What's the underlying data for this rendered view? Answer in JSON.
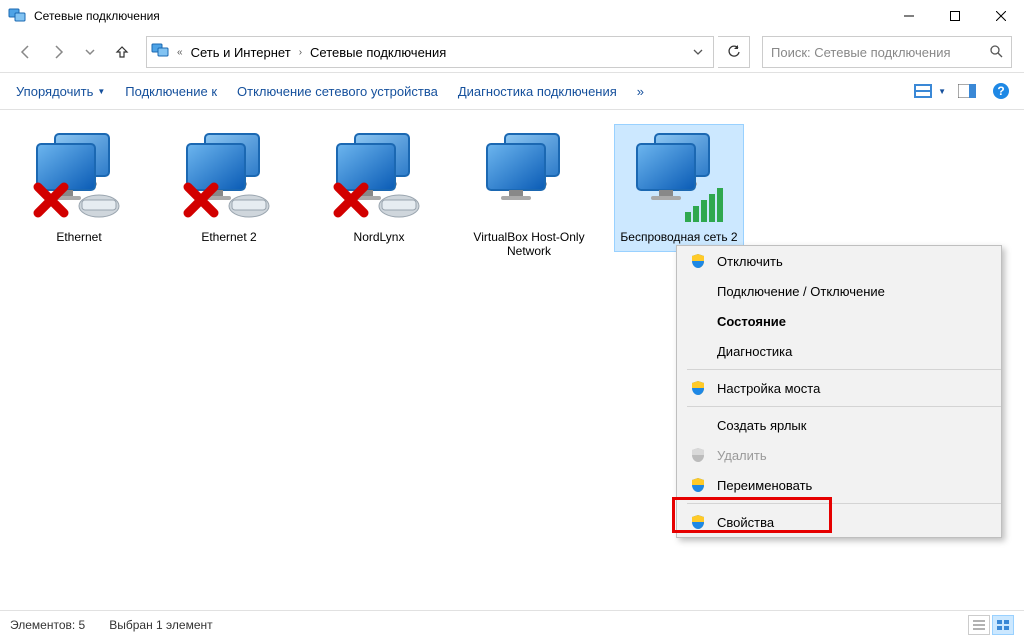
{
  "window": {
    "title": "Сетевые подключения"
  },
  "address": {
    "seg1": "Сеть и Интернет",
    "seg2": "Сетевые подключения"
  },
  "search": {
    "placeholder": "Поиск: Сетевые подключения"
  },
  "toolbar": {
    "organize": "Упорядочить",
    "connect": "Подключение к",
    "disable": "Отключение сетевого устройства",
    "diagnose": "Диагностика подключения",
    "overflow": "»"
  },
  "adapters": [
    {
      "label": "Ethernet",
      "disabled": true,
      "signal": false
    },
    {
      "label": "Ethernet 2",
      "disabled": true,
      "signal": false
    },
    {
      "label": "NordLynx",
      "disabled": true,
      "signal": false
    },
    {
      "label": "VirtualBox Host-Only Network",
      "disabled": false,
      "signal": false
    },
    {
      "label": "Беспроводная сеть 2",
      "disabled": false,
      "signal": true,
      "selected": true
    }
  ],
  "context_menu": {
    "items": [
      {
        "label": "Отключить",
        "shield": true
      },
      {
        "label": "Подключение / Отключение"
      },
      {
        "label": "Состояние",
        "bold": true
      },
      {
        "label": "Диагностика"
      },
      {
        "sep": true
      },
      {
        "label": "Настройка моста",
        "shield": true
      },
      {
        "sep": true
      },
      {
        "label": "Создать ярлык"
      },
      {
        "label": "Удалить",
        "shield": true,
        "disabled": true
      },
      {
        "label": "Переименовать",
        "shield": true
      },
      {
        "sep": true
      },
      {
        "label": "Свойства",
        "shield": true
      }
    ]
  },
  "status": {
    "count_label": "Элементов:",
    "count": "5",
    "selection": "Выбран 1 элемент"
  }
}
